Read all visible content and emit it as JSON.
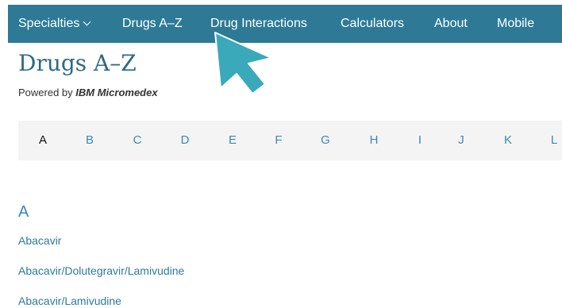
{
  "nav": {
    "specialties": "Specialties",
    "drugs_az": "Drugs A–Z",
    "drug_interactions": "Drug Interactions",
    "calculators": "Calculators",
    "about": "About",
    "mobile": "Mobile",
    "background_color": "#2e7a96"
  },
  "header": {
    "title": "Drugs A–Z",
    "powered_prefix": "Powered by",
    "powered_brand": "IBM Micromedex"
  },
  "alphabet": {
    "active": "A",
    "letters": [
      "A",
      "B",
      "C",
      "D",
      "E",
      "F",
      "G",
      "H",
      "I",
      "J",
      "K",
      "L"
    ]
  },
  "section": {
    "heading": "A",
    "drugs": [
      "Abacavir",
      "Abacavir/Dolutegravir/Lamivudine",
      "Abacavir/Lamivudine"
    ]
  },
  "colors": {
    "link": "#3a89b4",
    "title": "#2e6a86",
    "cursor_fill": "#3aa9ba"
  },
  "icons": {
    "pointer": "cursor-arrow-icon",
    "dropdown": "chevron-down-icon"
  }
}
